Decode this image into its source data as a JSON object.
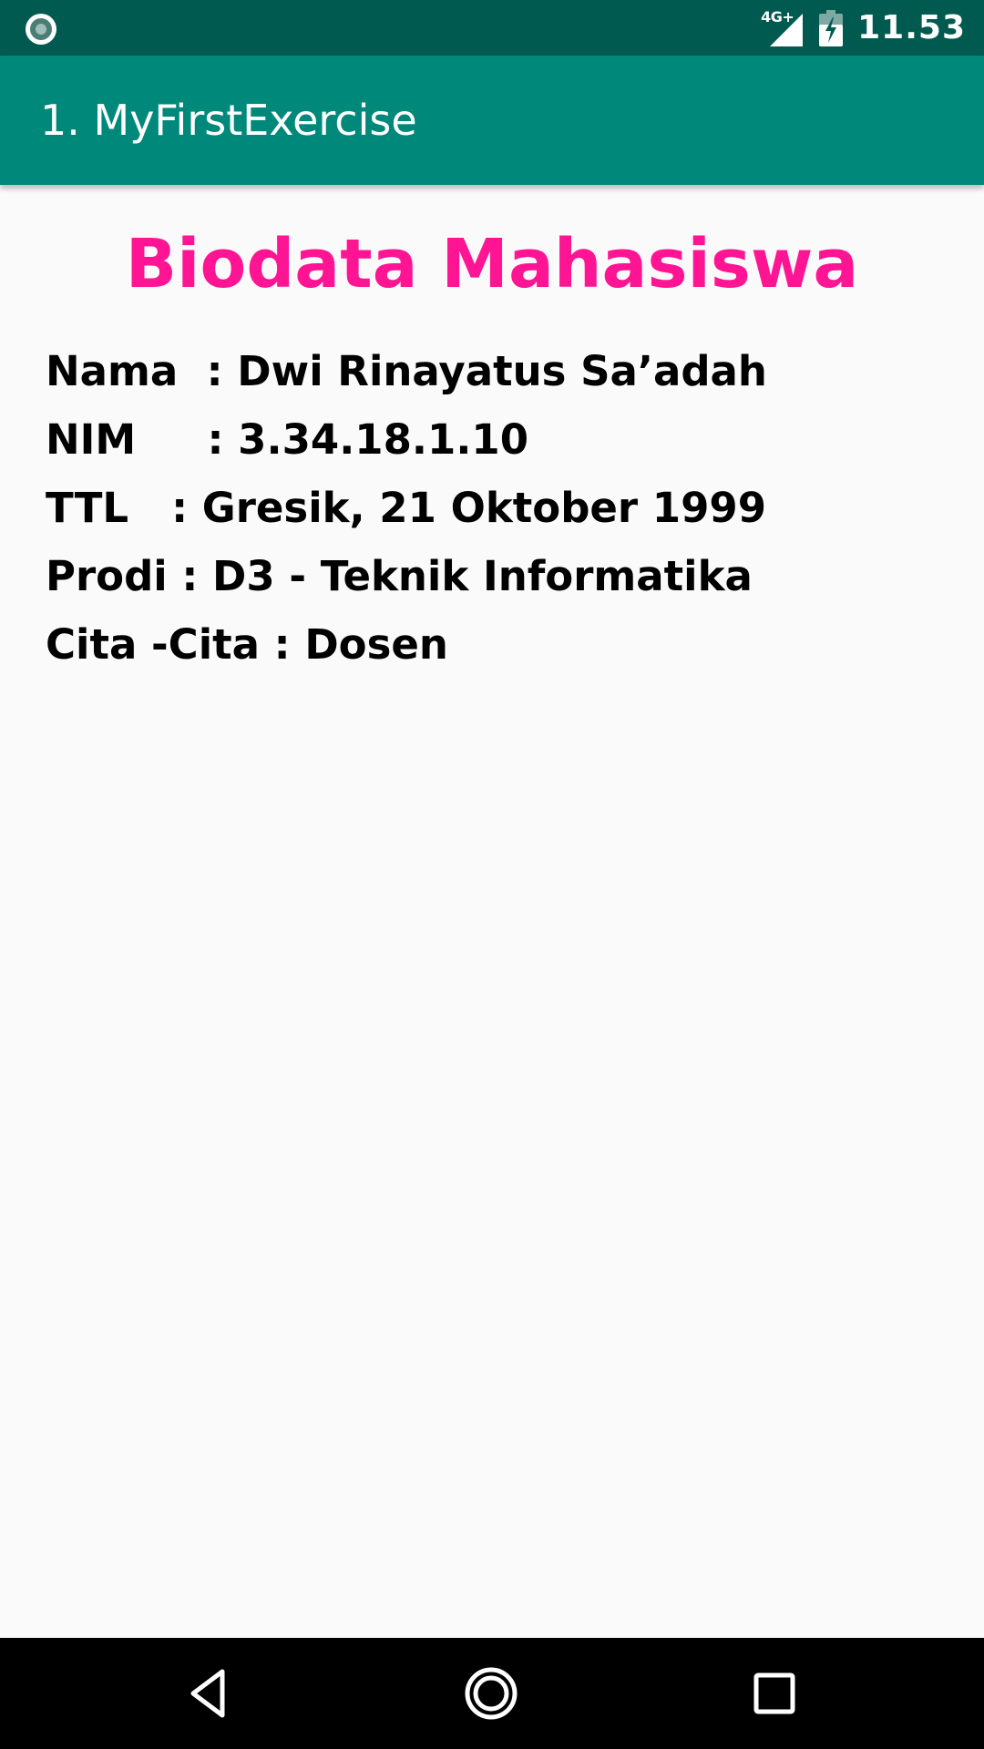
{
  "status_bar": {
    "network_type": "4G+",
    "time": "11.53",
    "icons": [
      "notification-circle-icon",
      "cell-signal-icon",
      "battery-charging-icon"
    ]
  },
  "app_bar": {
    "title": "1. MyFirstExercise"
  },
  "main": {
    "heading": "Biodata Mahasiswa",
    "lines": [
      "Nama  : Dwi Rinayatus Sa’adah",
      "NIM     : 3.34.18.1.10",
      "TTL   : Gresik, 21 Oktober 1999",
      "Prodi : D3 - Teknik Informatika",
      "Cita -Cita : Dosen"
    ]
  },
  "nav_bar": {
    "icons": [
      "back-icon",
      "home-icon",
      "recents-icon"
    ]
  },
  "colors": {
    "status_bar": "#005a4f",
    "app_bar": "#00897b",
    "heading": "#ff1493",
    "background": "#fafafa",
    "nav_bar": "#000000"
  }
}
